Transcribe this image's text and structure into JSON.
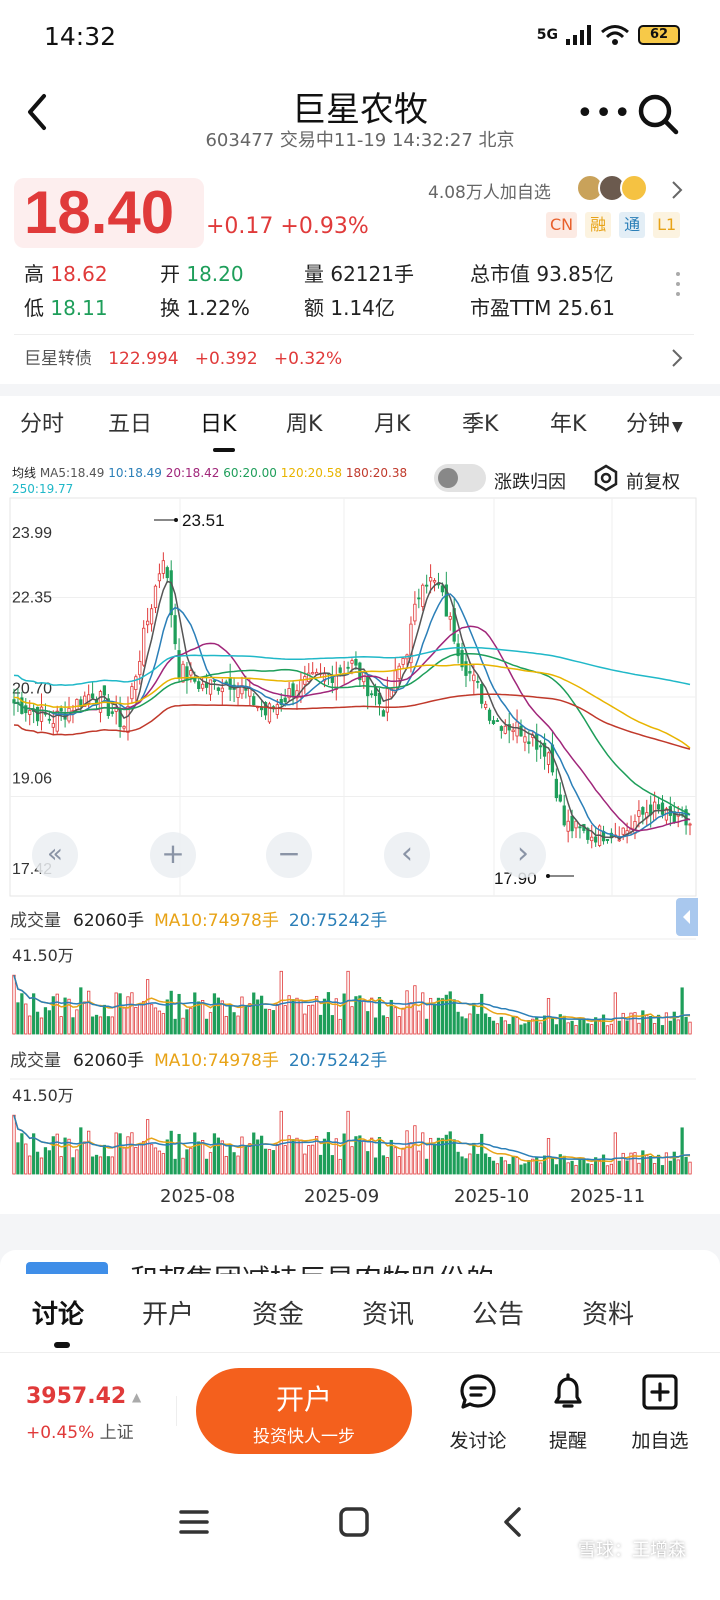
{
  "status": {
    "time": "14:32",
    "network": "5G",
    "battery": "62"
  },
  "header": {
    "title": "巨星农牧",
    "subtitle": "603477 交易中11-19 14:32:27 北京"
  },
  "quote": {
    "price": "18.40",
    "change": "+0.17 +0.93%",
    "followers": "4.08万人加自选",
    "badges": [
      {
        "label": "CN",
        "color": "#e8602c"
      },
      {
        "label": "融",
        "color": "#e8a317"
      },
      {
        "label": "通",
        "color": "#2b7fb8"
      },
      {
        "label": "L1",
        "color": "#e8a317"
      }
    ],
    "stats": {
      "high_label": "高",
      "high": "18.62",
      "open_label": "开",
      "open": "18.20",
      "vol_label": "量",
      "vol": "62121手",
      "mcap_label": "总市值",
      "mcap": "93.85亿",
      "low_label": "低",
      "low": "18.11",
      "turn_label": "换",
      "turn": "1.22%",
      "amt_label": "额",
      "amt": "1.14亿",
      "pe_label": "市盈TTM",
      "pe": "25.61"
    },
    "bond": {
      "name": "巨星转债",
      "price": "122.994",
      "change": "+0.392",
      "pct": "+0.32%"
    }
  },
  "period_tabs": [
    "分时",
    "五日",
    "日K",
    "周K",
    "月K",
    "季K",
    "年K",
    "分钟"
  ],
  "active_period": "日K",
  "ma_legend": {
    "label": "均线",
    "items": [
      {
        "text": "MA5:18.49",
        "color": "#555555"
      },
      {
        "text": "10:18.49",
        "color": "#2b7fb8"
      },
      {
        "text": "20:18.42",
        "color": "#a0267a"
      },
      {
        "text": "60:20.00",
        "color": "#1e9e5a"
      },
      {
        "text": "120:20.58",
        "color": "#e8b400"
      },
      {
        "text": "180:20.38",
        "color": "#c0392b"
      },
      {
        "text": "250:19.77",
        "color": "#20b8c8"
      }
    ]
  },
  "toggle_label": "涨跌归因",
  "adjust_label": "前复权",
  "chart_data": {
    "type": "candlestick",
    "y_ticks": [
      "23.99",
      "22.35",
      "20.70",
      "19.06",
      "17.42"
    ],
    "ylim": [
      17.42,
      23.99
    ],
    "annotations": [
      {
        "label": "23.51",
        "kind": "high"
      },
      {
        "label": "17.90",
        "kind": "low"
      }
    ],
    "x_labels": [
      "2025-08",
      "2025-09",
      "2025-10",
      "2025-11"
    ],
    "volume_max_label": "41.50万",
    "volume_header": {
      "label": "成交量",
      "value": "62060手",
      "ma10": "MA10:74978手",
      "ma20": "20:75242手"
    },
    "colors": {
      "up": "#e03a3a",
      "down": "#1e9e5a"
    }
  },
  "chart_controls": {
    "rewind": "«",
    "zoom_in": "+",
    "zoom_out": "−",
    "prev": "‹",
    "next": "›"
  },
  "news": {
    "text": "和邦集团减持巨星农牧股份的"
  },
  "bottom_tabs": [
    "讨论",
    "开户",
    "资金",
    "资讯",
    "公告",
    "资料"
  ],
  "index": {
    "value": "3957.42",
    "pct": "+0.45%",
    "name": "上证"
  },
  "open_account": {
    "label": "开户",
    "sub": "投资快人一步"
  },
  "actions": [
    {
      "label": "发讨论",
      "icon": "discuss-icon"
    },
    {
      "label": "提醒",
      "icon": "bell-icon"
    },
    {
      "label": "加自选",
      "icon": "add-watch-icon"
    }
  ],
  "watermark": "雪球：王增森"
}
